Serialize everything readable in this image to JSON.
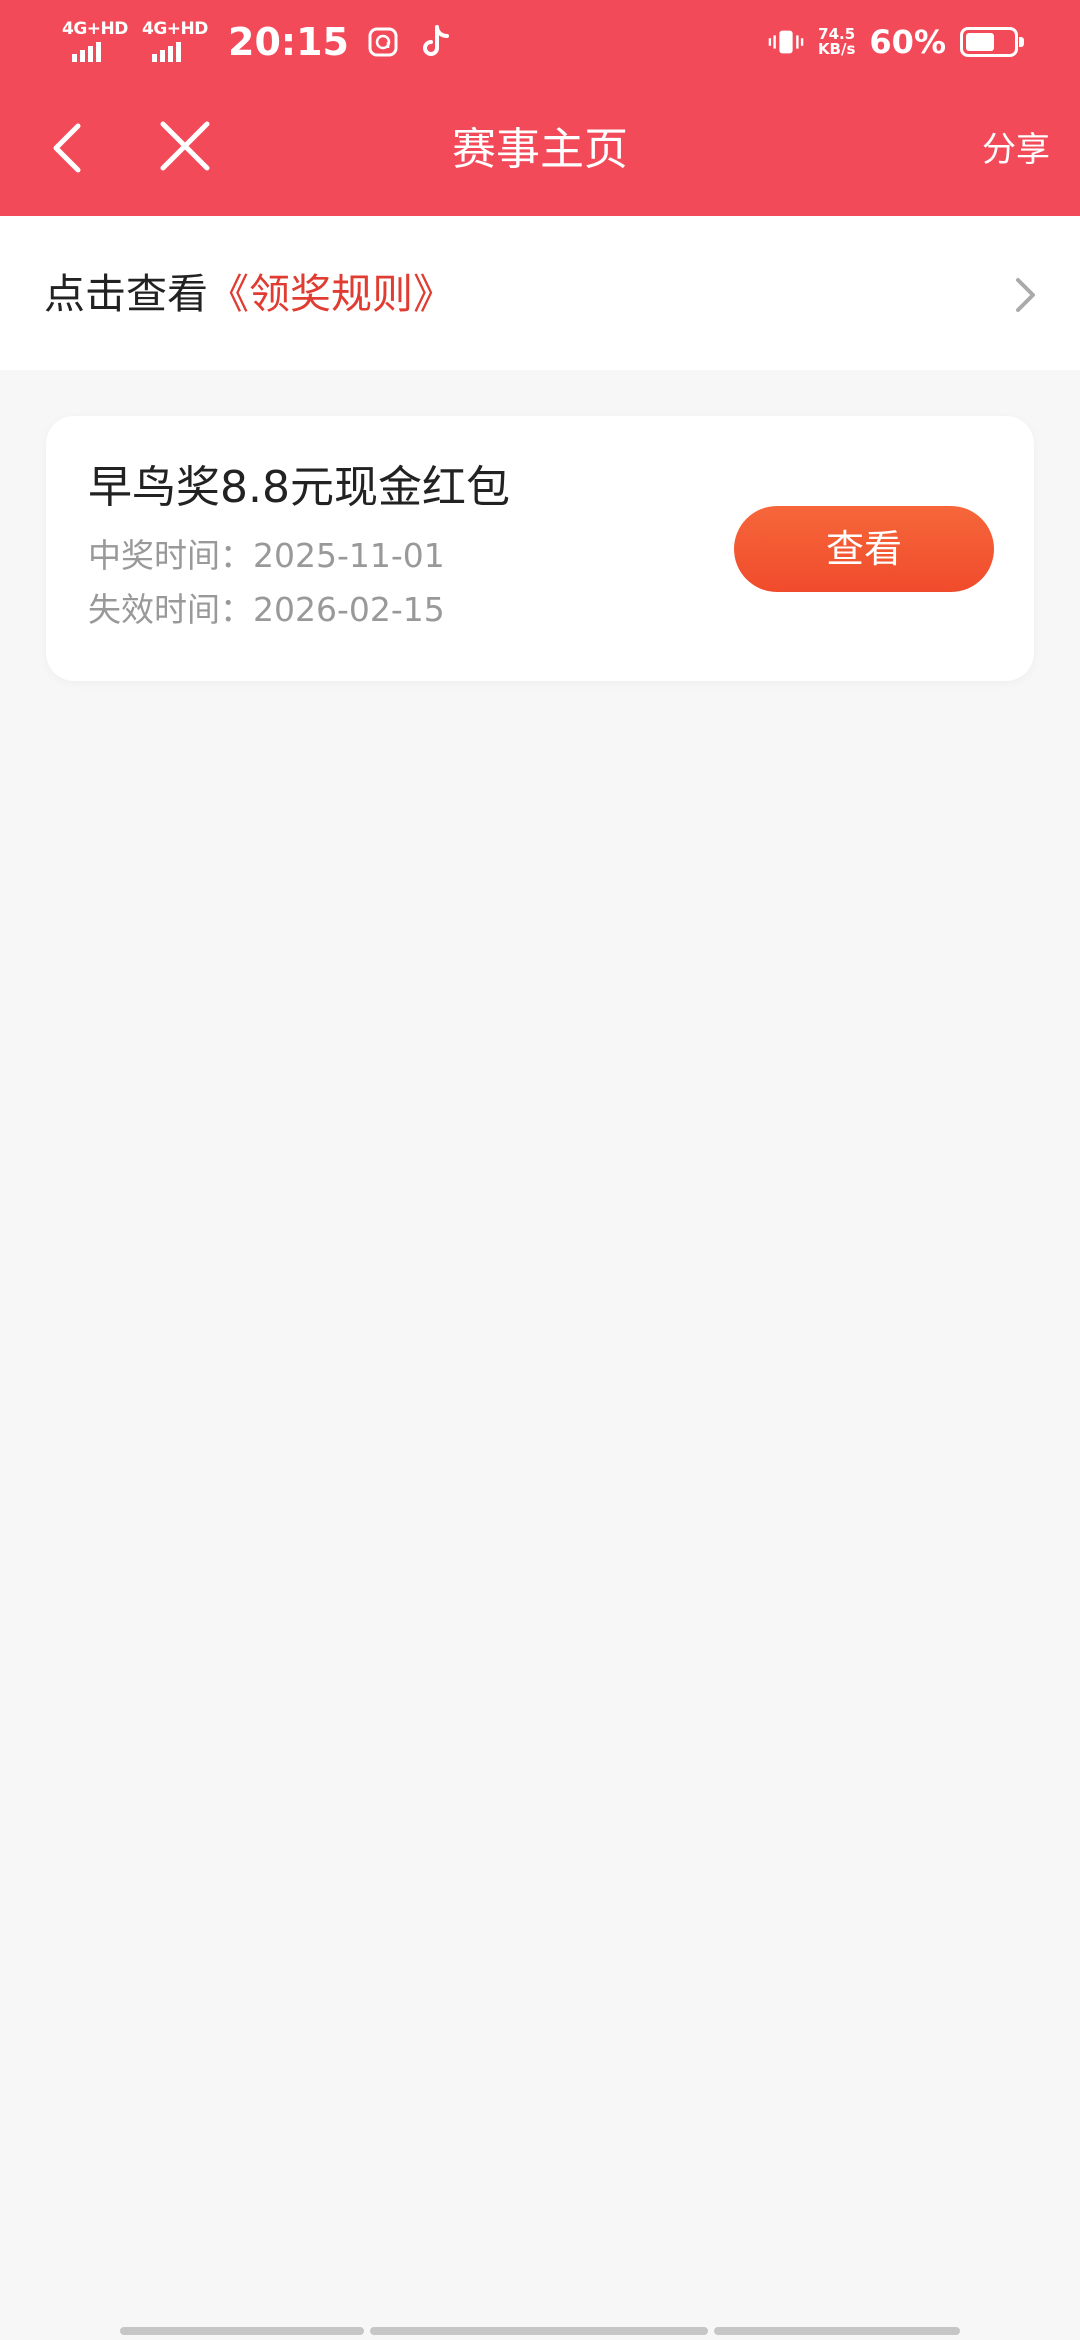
{
  "status_bar": {
    "network_1": "4G+HD",
    "network_2": "4G+HD",
    "time": "20:15",
    "speed_value": "74.5",
    "speed_unit": "KB/s",
    "battery_percent": "60%",
    "battery_level": 0.6,
    "icons": [
      "message-app-icon",
      "tiktok-icon",
      "vibrate-icon",
      "battery-icon"
    ]
  },
  "nav": {
    "title": "赛事主页",
    "share_label": "分享",
    "icons": [
      "back-chevron-icon",
      "close-icon"
    ]
  },
  "rules": {
    "prefix": "点击查看",
    "link": "《领奖规则》",
    "icon": "chevron-right-icon"
  },
  "prize": {
    "title": "早鸟奖8.8元现金红包",
    "win_time_label": "中奖时间：",
    "win_time": "2025-11-01",
    "expire_time_label": "失效时间：",
    "expire_time": "2026-02-15",
    "view_button": "查看"
  },
  "colors": {
    "header": "#f34a59",
    "link": "#e03c31",
    "button": "#f04b2c",
    "background": "#f7f7f7"
  }
}
